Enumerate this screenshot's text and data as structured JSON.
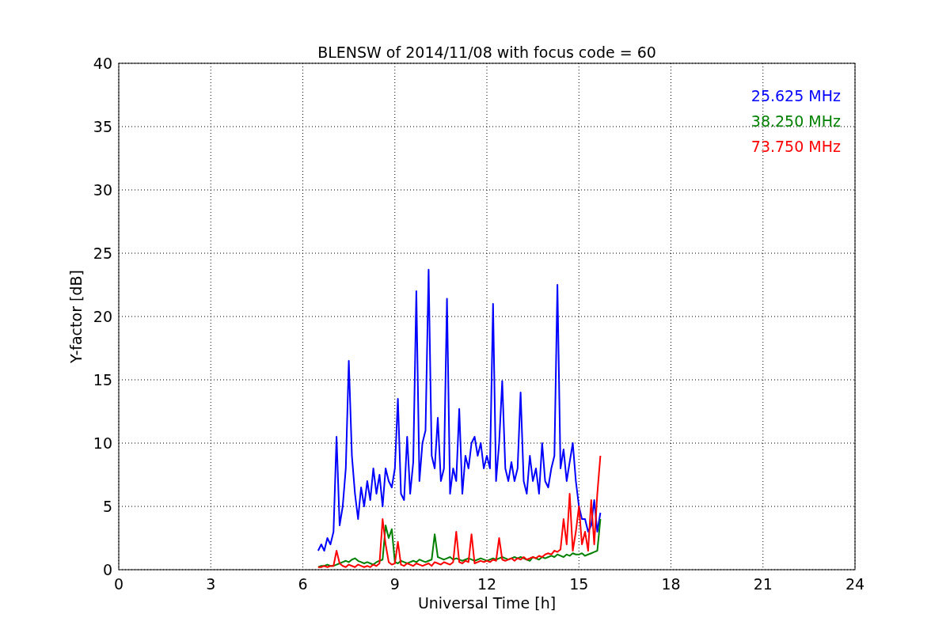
{
  "plot": {
    "chart_data": {
      "type": "line",
      "grid": true,
      "title": "BLENSW of 2014/11/08 with focus code = 60",
      "xlabel": "Universal Time [h]",
      "ylabel": "Y-factor [dB]",
      "xlim": [
        0,
        24
      ],
      "ylim": [
        0,
        40
      ],
      "xticks": [
        0,
        3,
        6,
        9,
        12,
        15,
        18,
        21,
        24
      ],
      "yticks": [
        0,
        5,
        10,
        15,
        20,
        25,
        30,
        35,
        40
      ],
      "x": [
        6.5,
        6.6,
        6.7,
        6.8,
        6.9,
        7.0,
        7.1,
        7.2,
        7.3,
        7.4,
        7.5,
        7.6,
        7.7,
        7.8,
        7.9,
        8.0,
        8.1,
        8.2,
        8.3,
        8.4,
        8.5,
        8.6,
        8.7,
        8.8,
        8.9,
        9.0,
        9.1,
        9.2,
        9.3,
        9.4,
        9.5,
        9.6,
        9.7,
        9.8,
        9.9,
        10.0,
        10.1,
        10.2,
        10.3,
        10.4,
        10.5,
        10.6,
        10.7,
        10.8,
        10.9,
        11.0,
        11.1,
        11.2,
        11.3,
        11.4,
        11.5,
        11.6,
        11.7,
        11.8,
        11.9,
        12.0,
        12.1,
        12.2,
        12.3,
        12.4,
        12.5,
        12.6,
        12.7,
        12.8,
        12.9,
        13.0,
        13.1,
        13.2,
        13.3,
        13.4,
        13.5,
        13.6,
        13.7,
        13.8,
        13.9,
        14.0,
        14.1,
        14.2,
        14.3,
        14.4,
        14.5,
        14.6,
        14.7,
        14.8,
        14.9,
        15.0,
        15.1,
        15.2,
        15.3,
        15.4,
        15.5,
        15.6,
        15.7
      ],
      "series": [
        {
          "name": "25.625 MHz",
          "color": "#0000ff",
          "values": [
            1.5,
            2,
            1.5,
            2.5,
            2,
            3,
            10.5,
            3.5,
            5,
            8,
            16.5,
            9,
            6,
            4,
            6.5,
            5,
            7,
            5.5,
            8,
            6,
            7.5,
            5,
            8,
            7,
            6.5,
            8,
            13.5,
            6,
            5.5,
            10.5,
            6,
            8.5,
            22,
            7,
            10,
            11,
            23.7,
            9,
            8,
            12,
            7,
            8,
            21.4,
            6,
            8,
            7,
            12.7,
            6,
            9,
            8,
            10,
            10.5,
            9,
            10,
            8,
            9,
            8,
            21,
            7,
            10,
            14.9,
            8,
            7,
            8.5,
            7,
            8,
            14,
            7,
            6,
            9,
            7,
            8,
            6,
            10,
            7,
            6.5,
            8,
            9,
            22.5,
            8,
            9.5,
            7,
            8.5,
            10,
            7,
            5,
            4,
            4,
            3,
            3.5,
            5.5,
            3,
            4.5
          ]
        },
        {
          "name": "38.250 MHz",
          "color": "#008000",
          "values": [
            0.2,
            0.3,
            0.3,
            0.4,
            0.3,
            0.3,
            0.4,
            0.5,
            0.6,
            0.7,
            0.6,
            0.8,
            0.9,
            0.7,
            0.6,
            0.5,
            0.6,
            0.5,
            0.4,
            0.6,
            0.7,
            0.8,
            3.5,
            2.5,
            3.2,
            0.6,
            0.5,
            0.7,
            0.6,
            0.5,
            0.6,
            0.7,
            0.6,
            0.8,
            0.7,
            0.6,
            0.7,
            0.8,
            2.8,
            1.0,
            0.9,
            0.8,
            0.9,
            1.0,
            0.8,
            0.9,
            0.8,
            0.7,
            0.8,
            0.9,
            0.8,
            0.7,
            0.8,
            0.9,
            0.8,
            0.7,
            0.8,
            0.9,
            0.8,
            0.9,
            1.0,
            0.9,
            0.8,
            0.9,
            1.0,
            0.9,
            1.0,
            0.9,
            0.8,
            0.7,
            1.0,
            0.9,
            0.8,
            1.0,
            0.9,
            1.0,
            1.1,
            1.0,
            1.2,
            1.1,
            1.0,
            1.2,
            1.1,
            1.3,
            1.2,
            1.2,
            1.3,
            1.1,
            1.2,
            1.3,
            1.4,
            1.5,
            4.0
          ]
        },
        {
          "name": "73.750 MHz",
          "color": "#ff0000",
          "values": [
            0.2,
            0.2,
            0.3,
            0.2,
            0.3,
            0.3,
            1.5,
            0.5,
            0.3,
            0.2,
            0.4,
            0.3,
            0.2,
            0.4,
            0.3,
            0.2,
            0.3,
            0.2,
            0.4,
            0.3,
            0.5,
            4.0,
            2.0,
            0.6,
            0.4,
            0.5,
            2.2,
            0.4,
            0.3,
            0.5,
            0.4,
            0.3,
            0.5,
            0.4,
            0.3,
            0.4,
            0.5,
            0.3,
            0.6,
            0.5,
            0.4,
            0.6,
            0.5,
            0.4,
            0.6,
            3.0,
            0.6,
            0.5,
            0.7,
            0.6,
            2.8,
            0.5,
            0.6,
            0.7,
            0.6,
            0.7,
            0.6,
            0.8,
            0.7,
            2.5,
            0.8,
            0.7,
            0.8,
            0.9,
            0.7,
            0.9,
            0.8,
            1.0,
            0.8,
            0.9,
            1.0,
            0.9,
            1.1,
            1.0,
            1.2,
            1.3,
            1.2,
            1.5,
            1.4,
            1.6,
            4.0,
            2.0,
            6.0,
            1.5,
            3.0,
            5.0,
            2.0,
            3.0,
            1.5,
            5.5,
            2.0,
            6.0,
            9.0
          ]
        }
      ]
    }
  }
}
